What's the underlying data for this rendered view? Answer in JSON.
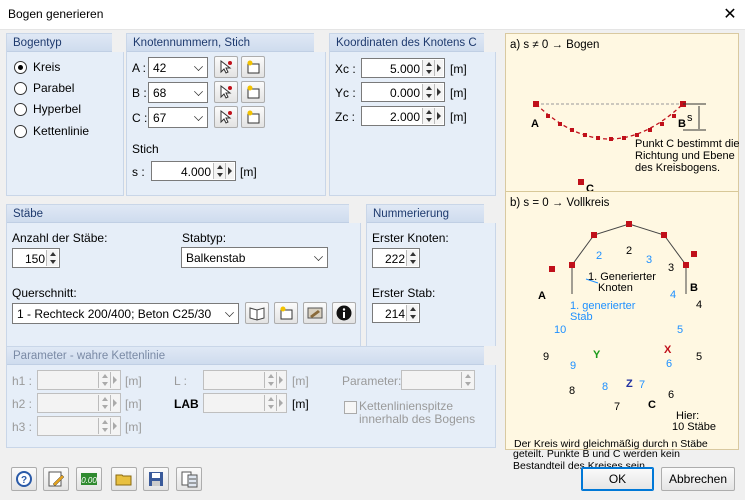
{
  "window": {
    "title": "Bogen generieren",
    "close_glyph": "✕"
  },
  "bogentyp": {
    "title": "Bogentyp",
    "options": [
      {
        "label": "Kreis",
        "selected": true
      },
      {
        "label": "Parabel",
        "selected": false
      },
      {
        "label": "Hyperbel",
        "selected": false
      },
      {
        "label": "Kettenlinie",
        "selected": false
      }
    ]
  },
  "knoten": {
    "title": "Knotennummern, Stich",
    "a_label": "A :",
    "a_value": "42",
    "b_label": "B :",
    "b_value": "68",
    "c_label": "C :",
    "c_value": "67",
    "stich_label": "Stich",
    "s_label": "s :",
    "s_value": "4.000",
    "s_unit": "[m]"
  },
  "koordinaten": {
    "title": "Koordinaten des Knotens C",
    "x_label": "Xc :",
    "x_value": "5.000",
    "x_unit": "[m]",
    "y_label": "Yc :",
    "y_value": "0.000",
    "y_unit": "[m]",
    "z_label": "Zc :",
    "z_value": "2.000",
    "z_unit": "[m]"
  },
  "staebe": {
    "title": "Stäbe",
    "anzahl_label": "Anzahl der Stäbe:",
    "anzahl_value": "150",
    "stabtyp_label": "Stabtyp:",
    "stabtyp_value": "Balkenstab",
    "querschnitt_label": "Querschnitt:",
    "querschnitt_value": "1 - Rechteck 200/400; Beton C25/30"
  },
  "nummerierung": {
    "title": "Nummerierung",
    "knoten_label": "Erster Knoten:",
    "knoten_value": "222",
    "stab_label": "Erster Stab:",
    "stab_value": "214"
  },
  "parameter": {
    "title": "Parameter - wahre Kettenlinie",
    "h1": "h1 :",
    "h2": "h2 :",
    "h3": "h3 :",
    "unit": "[m]",
    "l_label": "L :",
    "lab_label": "LAB :",
    "param_label": "Parameter:",
    "checkbox_label": "Kettenlinienspitze innerhalb des Bogens"
  },
  "info": {
    "a_title": "a) s ≠ 0 → Bogen",
    "a_labels": {
      "A": "A",
      "B": "B",
      "C": "C",
      "s": "s"
    },
    "a_text": [
      "Punkt C bestimmt die",
      "Richtung und Ebene",
      "des Kreisbogens."
    ],
    "b_title": "b) s = 0 → Vollkreis",
    "b_gen_knoten": [
      "1. Generierter",
      "Knoten"
    ],
    "b_gen_stab": [
      "1. generierter",
      "Stab"
    ],
    "b_axes": {
      "x": "X",
      "y": "Y",
      "z": "Z"
    },
    "b_hier": [
      "Hier:",
      "10 Stäbe"
    ],
    "b_text": [
      "Der Kreis wird gleichmäßig durch n Stäbe",
      "geteilt. Punkte B und C werden kein",
      "Bestandteil des Kreises sein."
    ],
    "node_numbers": [
      "2",
      "3",
      "4",
      "5",
      "6",
      "7",
      "8",
      "9",
      "A",
      "B",
      "C"
    ],
    "member_numbers": [
      "2",
      "3",
      "4",
      "5",
      "6",
      "7",
      "8",
      "9",
      "10",
      "1"
    ]
  },
  "footer": {
    "ok": "OK",
    "cancel": "Abbrechen"
  },
  "colors": {
    "accent": "#0078d7",
    "group_bg": "#e6eef8",
    "info_bg": "#fff8e2",
    "member_blue": "#1e90ff",
    "node_red": "#c0101a"
  }
}
